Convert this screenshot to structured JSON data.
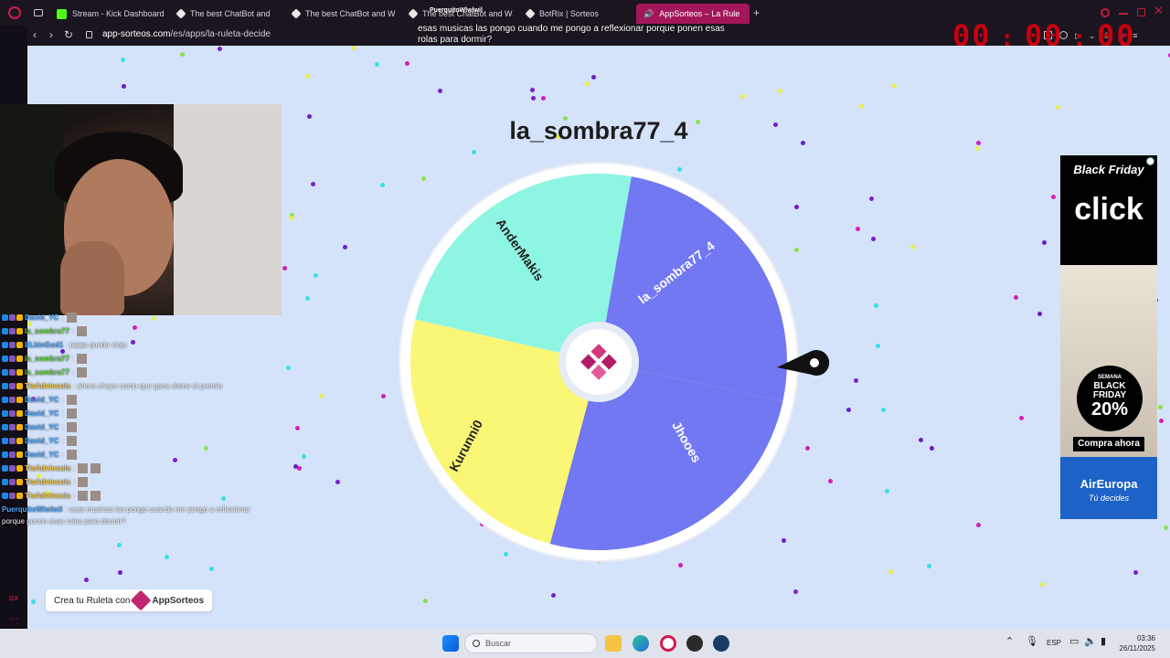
{
  "browser": {
    "tabs": [
      {
        "label": "Stream - Kick Dashboard",
        "icon": "kick-icon",
        "color": "#53fc18"
      },
      {
        "label": "The best ChatBot and",
        "icon": "botrix-icon",
        "color": "#e8e8e8"
      },
      {
        "label": "The best ChatBot and W",
        "icon": "botrix-icon",
        "color": "#e8e8e8"
      },
      {
        "label": "The best ChatBot and W",
        "icon": "botrix-icon",
        "color": "#e8e8e8"
      },
      {
        "label": "BotRix | Sorteos",
        "icon": "botrix-icon",
        "color": "#e8e8e8"
      },
      {
        "label": "AppSorteos – La Rule",
        "icon": "audio-icon",
        "color": "#ffffff",
        "active": true
      }
    ],
    "url_host": "app-sorteos.com",
    "url_path": "/es/apps/la-ruleta-decide"
  },
  "overlay": {
    "username": "PuerquitoWlwlwil",
    "message": "esas musicas las pongo cuando me pongo a reflexionar porque ponen esas rolas para dormir?"
  },
  "timer": {
    "hours": "00",
    "sep1": ":",
    "minutes": "00",
    "sep2": ":",
    "seconds": "00"
  },
  "roulette": {
    "winner_title": "la_sombra77_4",
    "segments": [
      {
        "name": "AnderMakis",
        "color": "#8ef5e2"
      },
      {
        "name": "la_sombra77_4",
        "color": "#7178f2"
      },
      {
        "name": "Jhooes",
        "color": "#7178f2"
      },
      {
        "name": "Kurunni0",
        "color": "#faf676"
      }
    ],
    "brand_text": "Crea tu Ruleta con",
    "brand_name": "AppSorteos"
  },
  "chat": {
    "lines": [
      {
        "user": "David_YC",
        "color": "#4aa8ff",
        "text": ":",
        "emotes": 1
      },
      {
        "user": "la_sombra77",
        "color": "#60d040",
        "text": ":",
        "emotes": 1
      },
      {
        "user": "ELkinGod1",
        "color": "#4aa8ff",
        "text": ": jajaja quede viejo",
        "emotes": 0
      },
      {
        "user": "la_sombra77",
        "color": "#60d040",
        "text": ":",
        "emotes": 1
      },
      {
        "user": "la_sombra77",
        "color": "#60d040",
        "text": ":",
        "emotes": 1
      },
      {
        "user": "TioAdvincula",
        "color": "#f5c542",
        "text": ": ahora chayo como que gane dame el premio",
        "emotes": 0
      },
      {
        "user": "David_YC",
        "color": "#4aa8ff",
        "text": ":",
        "emotes": 1
      },
      {
        "user": "David_YC",
        "color": "#4aa8ff",
        "text": ":",
        "emotes": 1
      },
      {
        "user": "David_YC",
        "color": "#4aa8ff",
        "text": ":",
        "emotes": 1
      },
      {
        "user": "David_YC",
        "color": "#4aa8ff",
        "text": ":",
        "emotes": 1
      },
      {
        "user": "David_YC",
        "color": "#4aa8ff",
        "text": ":",
        "emotes": 1
      },
      {
        "user": "TioAdvincula",
        "color": "#f5c542",
        "text": ":",
        "emotes": 2
      },
      {
        "user": "TioAdvincula",
        "color": "#f5c542",
        "text": ":",
        "emotes": 1
      },
      {
        "user": "TioAdvincula",
        "color": "#f5c542",
        "text": ":",
        "emotes": 2
      }
    ],
    "last_user": "PuerquitoWlwlwil",
    "last_text": ": esas musicas las pongo cuando me pongo a reflexionar",
    "last_text_2": "porque ponen esas rolas para dormir?"
  },
  "ad": {
    "headline": "Black Friday",
    "click": "click",
    "badge_week": "SEMANA",
    "badge_title": "BLACK FRIDAY",
    "badge_pct": "20%",
    "cta": "Compra ahora",
    "airline": "AirEuropa",
    "airline_sub": "Tú decides"
  },
  "taskbar": {
    "search_placeholder": "Buscar",
    "lang": "ESP",
    "time": "03:36",
    "date": "26/11/2025"
  },
  "opera_gx_label": "GX"
}
